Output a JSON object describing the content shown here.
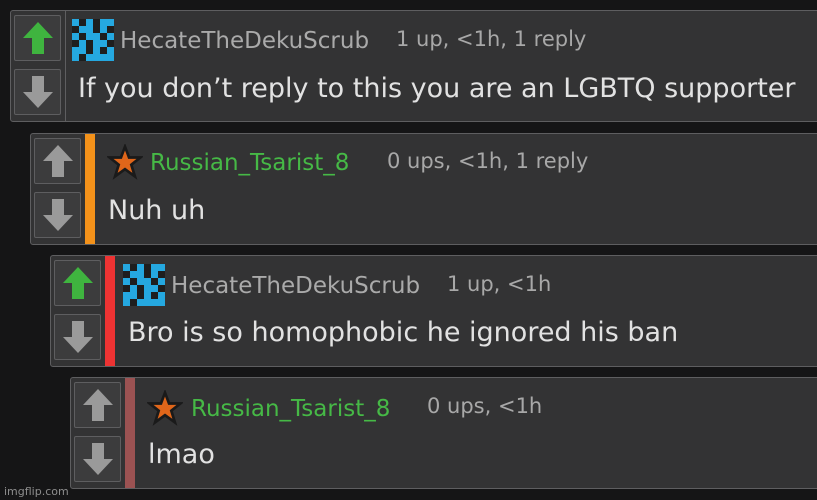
{
  "colors": {
    "upvote_active": "#3fb43f",
    "arrow_inactive": "#9a9a9a",
    "username_blue": "#aaaaaa",
    "username_green": "#46b946",
    "accent_orange": "#f4921a",
    "accent_red": "#ee3333",
    "accent_brown": "#9b5252"
  },
  "comments": [
    {
      "username": "HecateTheDekuScrub",
      "meta": "1 up, <1h, 1 reply",
      "text": "If you don’t reply to this you are an LGBTQ supporter",
      "upvoted": true,
      "avatar": "blue-pixel-avatar-icon"
    },
    {
      "username": "Russian_Tsarist_8",
      "meta": "0 ups, <1h, 1 reply",
      "text": "Nuh uh",
      "upvoted": false,
      "avatar": "orange-star-icon"
    },
    {
      "username": "HecateTheDekuScrub",
      "meta": "1 up, <1h",
      "text": "Bro is so homophobic he ignored his ban",
      "upvoted": true,
      "avatar": "blue-pixel-avatar-icon"
    },
    {
      "username": "Russian_Tsarist_8",
      "meta": "0 ups, <1h",
      "text": "lmao",
      "upvoted": false,
      "avatar": "orange-star-icon"
    }
  ],
  "watermark": "imgflip.com"
}
